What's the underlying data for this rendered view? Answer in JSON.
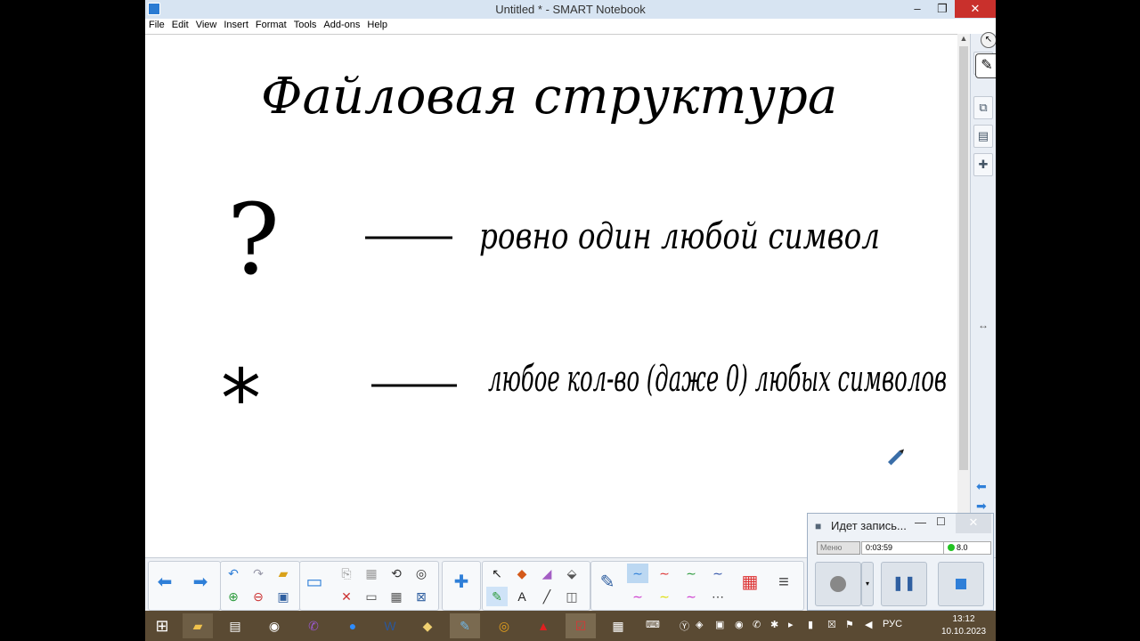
{
  "window": {
    "title": "Untitled * - SMART Notebook",
    "minimize": "–",
    "maximize": "❐",
    "close": "✕"
  },
  "menu": [
    "File",
    "Edit",
    "View",
    "Insert",
    "Format",
    "Tools",
    "Add-ons",
    "Help"
  ],
  "whiteboard": {
    "heading": "Файловая структура",
    "rules": [
      {
        "symbol": "?",
        "dash": "—",
        "description": "ровно один любой символ"
      },
      {
        "symbol": "*",
        "dash": "—",
        "description": "любое кол-во (даже 0) любых символов"
      }
    ]
  },
  "recorder": {
    "title": "Идет запись...",
    "menu_label": "Меню",
    "elapsed": "0:03:59",
    "level": "8.0",
    "minimize": "—",
    "maximize": "☐",
    "close": "✕"
  },
  "taskbar": {
    "tray_lang": "РУС",
    "time": "13:12",
    "date": "10.10.2023"
  },
  "colors": {
    "titlebar": "#d7e4f2",
    "taskbar": "#5a4a33",
    "ink": "#000000",
    "accent_arrow": "#2f7fd8"
  }
}
